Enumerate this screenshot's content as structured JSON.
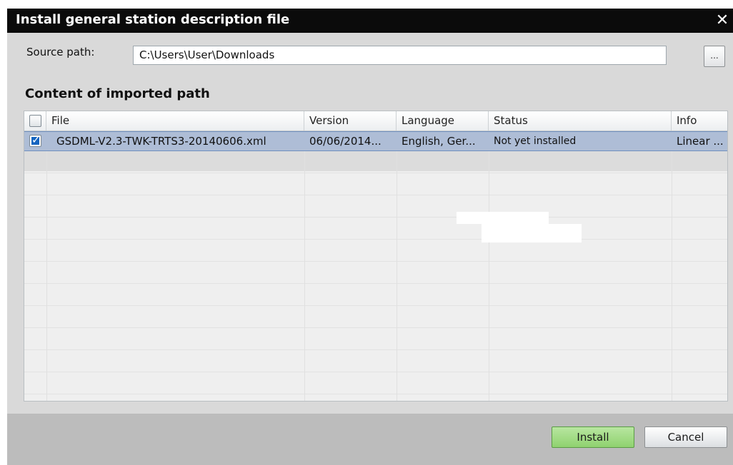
{
  "dialog": {
    "title": "Install general station description file",
    "close_glyph": "✕"
  },
  "source": {
    "label": "Source path:",
    "value": "C:\\Users\\User\\Downloads",
    "browse_label": "..."
  },
  "content": {
    "section_title": "Content of imported path",
    "columns": [
      "File",
      "Version",
      "Language",
      "Status",
      "Info"
    ],
    "rows": [
      {
        "checked": true,
        "file": "GSDML-V2.3-TWK-TRTS3-20140606.xml",
        "version": "06/06/2014...",
        "language": "English, Ger...",
        "status": "Not yet installed",
        "info": "Linear ..."
      }
    ]
  },
  "buttons": {
    "install": "Install",
    "cancel": "Cancel"
  },
  "colors": {
    "titlebar": "#0b0b0b",
    "selection": "#aebdd6",
    "install_button": "#8fd26f"
  }
}
